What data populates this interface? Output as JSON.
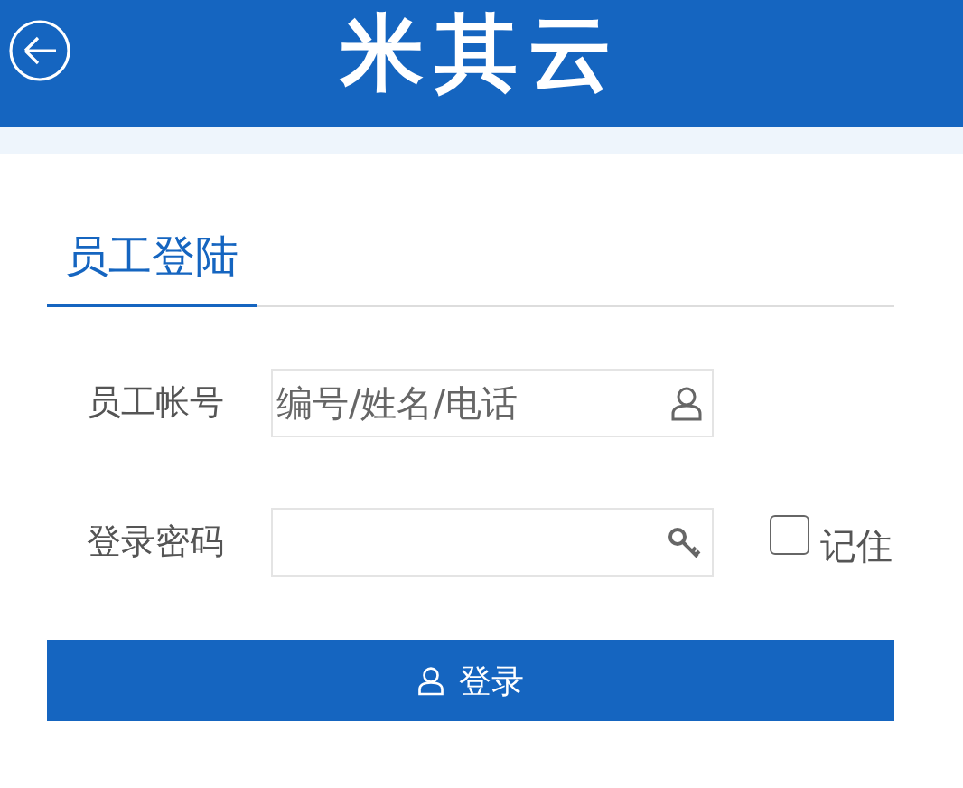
{
  "header": {
    "title": "米其云"
  },
  "section_tab": {
    "label": "员工登陆",
    "selected": true
  },
  "fields": [
    {
      "kind": "account",
      "label": "员工帐号",
      "placeholder": "编号/姓名/电话"
    },
    {
      "kind": "password",
      "label": "登录密码"
    }
  ],
  "remember": {
    "label": "记住",
    "checked": false
  },
  "login_button": {
    "label": "登录"
  }
}
